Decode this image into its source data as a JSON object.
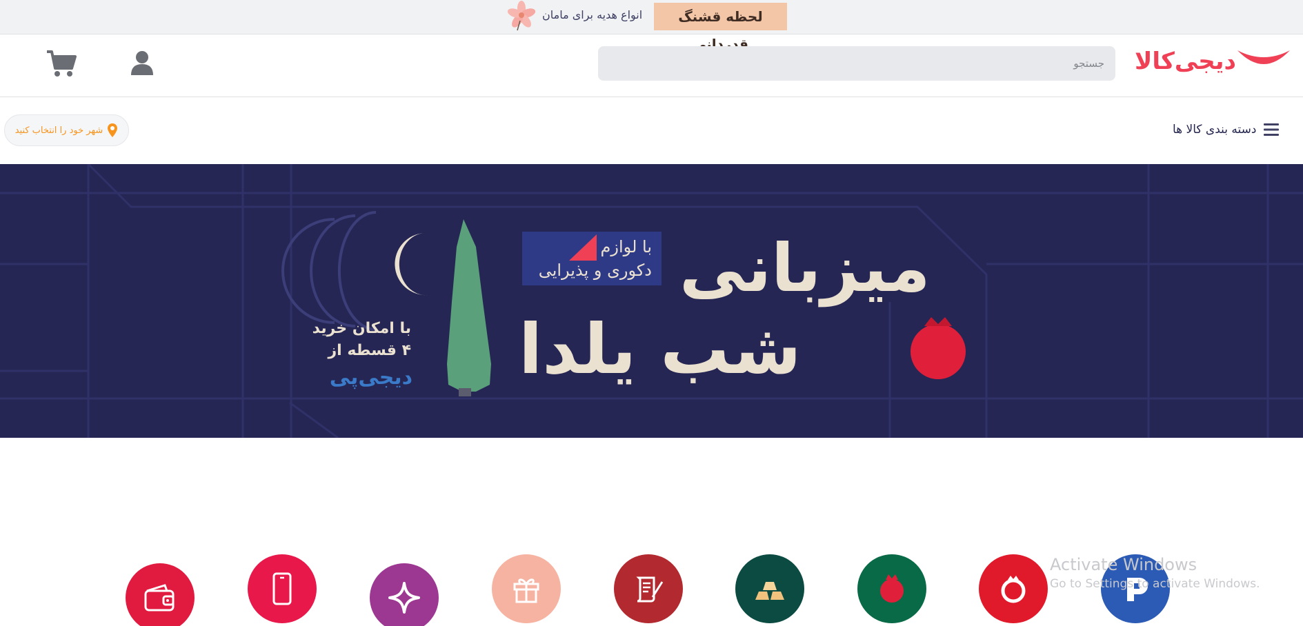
{
  "promo": {
    "badge": "لحظه قشنگ قدردانی",
    "text": "انواع هدیه برای مامان"
  },
  "header": {
    "logo_text": "دیجی‌کالا",
    "search_placeholder": "جستجو"
  },
  "nav": {
    "categories_label": "دسته بندی کالا ها",
    "city_label": "شهر خود را انتخاب کنید"
  },
  "banner": {
    "title_line1": "میزبانی",
    "title_line2": "شب یلدا",
    "tag_line1": "با لوازم",
    "tag_line2": "دکوری و پذیرایی",
    "side_line1": "با امکان خرید",
    "side_line2": "۴ قسطه از",
    "side_brand": "دیجی‌پی"
  },
  "quick_links": [
    {
      "icon": "digipay-icon",
      "color": "#2c5bb5"
    },
    {
      "icon": "pomegranate-ring-icon",
      "color": "#e11a2b"
    },
    {
      "icon": "pomegranate-icon",
      "color": "#086a46"
    },
    {
      "icon": "gold-bars-icon",
      "color": "#0b4b42"
    },
    {
      "icon": "scroll-quill-icon",
      "color": "#b2292f"
    },
    {
      "icon": "gift-icon",
      "color": "#f7b3a1"
    },
    {
      "icon": "sparkle-icon",
      "color": "#9d3892"
    },
    {
      "icon": "phone-icon",
      "color": "#e8194a"
    },
    {
      "icon": "wallet-icon",
      "color": "#e11a3f"
    }
  ],
  "watermark": {
    "line1": "Activate Windows",
    "line2": "Go to Settings to activate Windows."
  },
  "colors": {
    "brand": "#ef4056",
    "banner_bg": "#252654",
    "promo_badge": "#f3c6a8"
  }
}
